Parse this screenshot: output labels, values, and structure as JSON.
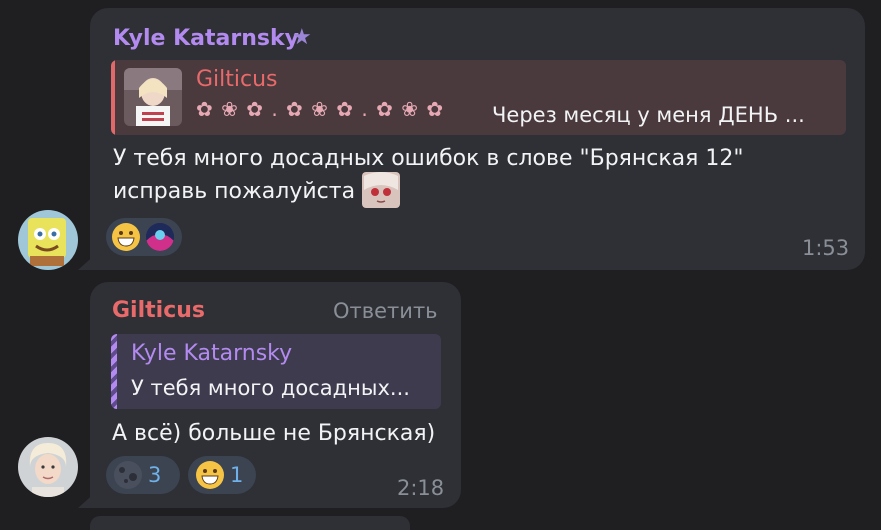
{
  "colors": {
    "background": "#1f1f21",
    "bubble": "#2e3035",
    "kyle_name": "#b38bf0",
    "gilticus_name": "#e86a6a",
    "reaction_count": "#6fb2e9",
    "meta": "#8a8f97"
  },
  "message1": {
    "sender": "Kyle Katarnsky",
    "badge_icon": "star-icon",
    "quote": {
      "author": "Gilticus",
      "text": "Через месяц у меня ДЕНЬ ..."
    },
    "text_line1": "У тебя много досадных ошибок в слове \"Брянская 12\"",
    "text_line2": "исправь пожалуйста",
    "reactions": [
      {
        "emoji": "grinning-face"
      },
      {
        "emoji": "custom-avatar"
      }
    ],
    "time": "1:53"
  },
  "message2": {
    "sender": "Gilticus",
    "reply_label": "Ответить",
    "quote": {
      "author": "Kyle Katarnsky",
      "text": "У тебя много досадных..."
    },
    "text": "А всё) больше не Брянская)",
    "reactions": [
      {
        "emoji": "new-moon-face",
        "count": "3"
      },
      {
        "emoji": "grinning-face",
        "count": "1"
      }
    ],
    "time": "2:18"
  }
}
